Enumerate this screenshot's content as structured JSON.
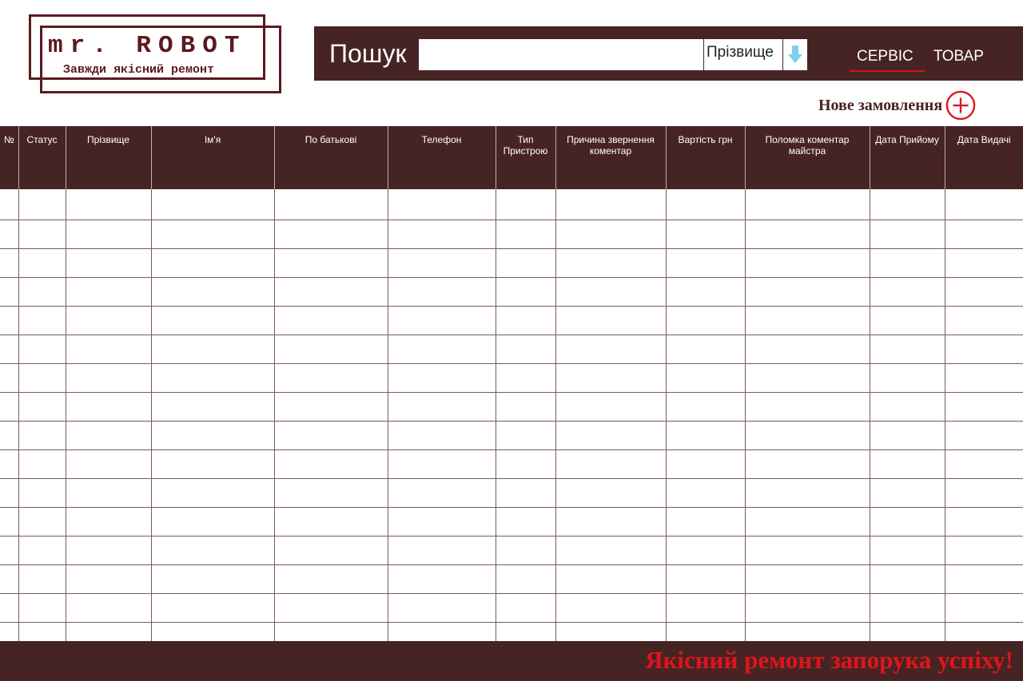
{
  "logo": {
    "title": "mr. ROBOT",
    "tagline": "Завжди якісний ремонт"
  },
  "header": {
    "search_label": "Пошук",
    "search_value": "",
    "search_field_selected": "Прізвище",
    "nav": {
      "service": "СЕРВІС",
      "goods": "ТОВАР",
      "active": "СЕРВІС"
    }
  },
  "new_order": {
    "label": "Нове замовлення",
    "icon": "plus-circle-icon"
  },
  "table": {
    "columns": [
      "№",
      "Статус",
      "Прізвище",
      "Ім'я",
      "По батькові",
      "Телефон",
      "Тип Пристрою",
      "Причина звернення коментар",
      "Вартість грн",
      "Поломка коментар майстра",
      "Дата Прийому",
      "Дата Видачі"
    ],
    "rows": [
      [
        "",
        "",
        "",
        "",
        "",
        "",
        "",
        "",
        "",
        "",
        "",
        ""
      ],
      [
        "",
        "",
        "",
        "",
        "",
        "",
        "",
        "",
        "",
        "",
        "",
        ""
      ],
      [
        "",
        "",
        "",
        "",
        "",
        "",
        "",
        "",
        "",
        "",
        "",
        ""
      ],
      [
        "",
        "",
        "",
        "",
        "",
        "",
        "",
        "",
        "",
        "",
        "",
        ""
      ],
      [
        "",
        "",
        "",
        "",
        "",
        "",
        "",
        "",
        "",
        "",
        "",
        ""
      ],
      [
        "",
        "",
        "",
        "",
        "",
        "",
        "",
        "",
        "",
        "",
        "",
        ""
      ],
      [
        "",
        "",
        "",
        "",
        "",
        "",
        "",
        "",
        "",
        "",
        "",
        ""
      ],
      [
        "",
        "",
        "",
        "",
        "",
        "",
        "",
        "",
        "",
        "",
        "",
        ""
      ],
      [
        "",
        "",
        "",
        "",
        "",
        "",
        "",
        "",
        "",
        "",
        "",
        ""
      ],
      [
        "",
        "",
        "",
        "",
        "",
        "",
        "",
        "",
        "",
        "",
        "",
        ""
      ],
      [
        "",
        "",
        "",
        "",
        "",
        "",
        "",
        "",
        "",
        "",
        "",
        ""
      ],
      [
        "",
        "",
        "",
        "",
        "",
        "",
        "",
        "",
        "",
        "",
        "",
        ""
      ],
      [
        "",
        "",
        "",
        "",
        "",
        "",
        "",
        "",
        "",
        "",
        "",
        ""
      ],
      [
        "",
        "",
        "",
        "",
        "",
        "",
        "",
        "",
        "",
        "",
        "",
        ""
      ],
      [
        "",
        "",
        "",
        "",
        "",
        "",
        "",
        "",
        "",
        "",
        "",
        ""
      ],
      [
        "",
        "",
        "",
        "",
        "",
        "",
        "",
        "",
        "",
        "",
        "",
        ""
      ],
      [
        "",
        "",
        "",
        "",
        "",
        "",
        "",
        "",
        "",
        "",
        "",
        ""
      ]
    ]
  },
  "footer": {
    "slogan": "Якісний ремонт запорука успіху!"
  },
  "colors": {
    "primary": "#472424",
    "logo": "#5a1a1e",
    "accent_red": "#e0141c",
    "arrow_blue": "#7ccfe8"
  }
}
